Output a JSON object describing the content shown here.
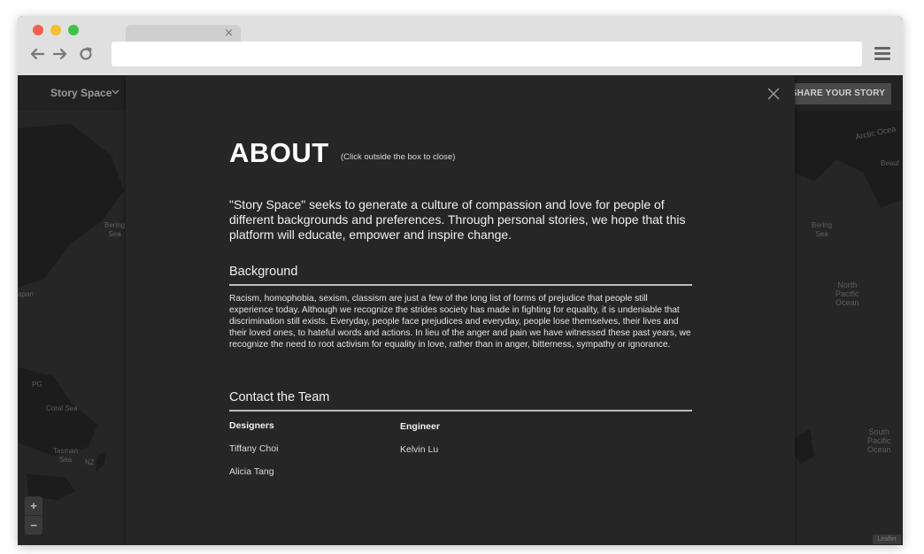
{
  "browser": {
    "tab_close_glyph": "×"
  },
  "app": {
    "brand": "Story Space",
    "share_button": "SHARE YOUR STORY"
  },
  "map": {
    "labels": [
      {
        "text": "Arctic Ocea",
        "name": "map-label-arctic"
      },
      {
        "text": "Beauf",
        "name": "map-label-beaufort"
      },
      {
        "text": "Bering\nSea",
        "name": "map-label-bering-right"
      },
      {
        "text": "Bering\nSea",
        "name": "map-label-bering-left"
      },
      {
        "text": "North\nPacific\nOcean",
        "name": "map-label-north-pacific"
      },
      {
        "text": "apan",
        "name": "map-label-japan"
      },
      {
        "text": "PG",
        "name": "map-label-png"
      },
      {
        "text": "Coral Sea",
        "name": "map-label-coral-sea"
      },
      {
        "text": "Tasman\nSea",
        "name": "map-label-tasman"
      },
      {
        "text": "NZ",
        "name": "map-label-nz"
      },
      {
        "text": "South\nPacific\nOcean",
        "name": "map-label-south-pacific"
      }
    ],
    "zoom_in": "+",
    "zoom_out": "−",
    "attribution": "Leaflet"
  },
  "modal": {
    "title": "ABOUT",
    "hint": "(Click outside the box to close)",
    "intro": "\"Story Space\" seeks to generate a culture of compassion and love for people of different backgrounds and preferences. Through personal stories, we hope that this platform will educate, empower and inspire change.",
    "background_heading": "Background",
    "background_text": "Racism, homophobia, sexism, classism are just a few of the long list of forms of prejudice that people still experience today. Although we recognize the strides society has made in fighting for equality, it is undeniable that discrimination still exists. Everyday, people face prejudices and everyday, people lose themselves, their lives and their loved ones, to hateful words and actions. In lieu of the anger and pain we have witnessed these past years, we recognize the need to root activism for equality in love, rather than in anger, bitterness, sympathy or ignorance.",
    "contact_heading": "Contact the Team",
    "designers_heading": "Designers",
    "designers": [
      "Tiffany Choi",
      "Alicia Tang"
    ],
    "engineer_heading": "Engineer",
    "engineers": [
      "Kelvin Lu"
    ]
  }
}
